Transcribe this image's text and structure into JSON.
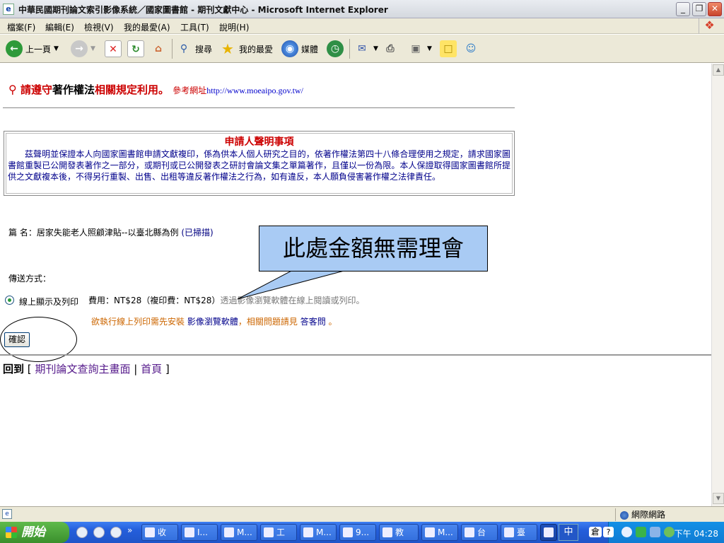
{
  "window": {
    "title": "中華民國期刊論文索引影像系統／國家圖書館 - 期刊文獻中心 - Microsoft Internet Explorer",
    "icon": "ie-page-icon"
  },
  "menu": [
    "檔案(F)",
    "編輯(E)",
    "檢視(V)",
    "我的最愛(A)",
    "工具(T)",
    "說明(H)"
  ],
  "toolbar": {
    "back": "上一頁",
    "search": "搜尋",
    "favorites": "我的最愛",
    "media": "媒體"
  },
  "page": {
    "copyright": {
      "part1": "請遵守",
      "part2": "著作權法",
      "part3": "相關規定利用。",
      "ref_label": "參考網址",
      "ref_url": "http://www.moeaipo.gov.tw/"
    },
    "declaration": {
      "title": "申請人聲明事項",
      "body": "茲聲明並保證本人向國家圖書館申請文獻複印，係為供本人個人研究之目的，依著作權法第四十八條合理使用之規定，請求國家圖書館重製已公開發表著作之一部分，或期刊或已公開發表之研討會論文集之單篇著作，且僅以一份為限。本人保證取得國家圖書館所提供之文獻複本後，不得另行重製、出售、出租等違反著作權法之行為，如有違反，本人願負侵害著作權之法律責任。"
    },
    "article_label": "篇 名：",
    "article_title": "居家失能老人照顧津貼--以臺北縣為例",
    "article_note": "(已掃描)",
    "delivery_label": "傳送方式：",
    "option_label": "線上顯示及列印",
    "fee_text": "費用：NT$28（複印費：NT$28）",
    "fee_note": "透過影像瀏覽軟體在線上閱讀或列印。",
    "install": {
      "prefix": "欲執行線上列印需先安裝",
      "link1": "影像瀏覽軟體",
      "middle": "，相關問題請見",
      "link2": "答客問",
      "suffix": "。"
    },
    "confirm": "確認",
    "back": {
      "label": "回到",
      "open": "[",
      "link1": "期刊論文查詢主畫面",
      "divider": "|",
      "link2": "首頁",
      "close": "]"
    }
  },
  "callout": "此處金額無需理會",
  "status": {
    "zone": "網際網路"
  },
  "taskbar": {
    "start": "開始",
    "tasks": [
      "收",
      "I...",
      "M...",
      "工",
      "M...",
      "9...",
      "教",
      "M...",
      "台",
      "臺",
      "中"
    ],
    "lang": "倉",
    "clock": "下午 04:28"
  }
}
